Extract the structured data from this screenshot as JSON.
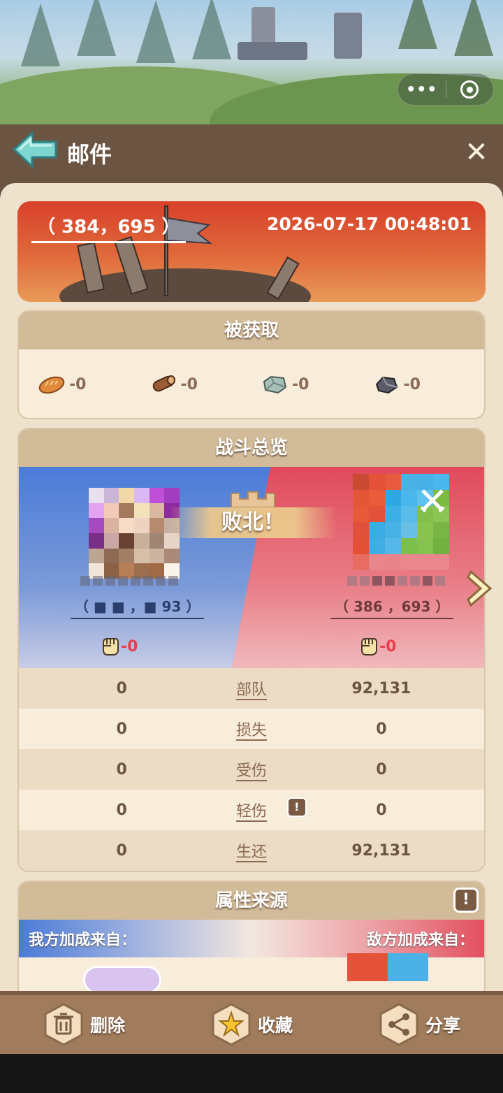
{
  "system": {
    "capsule_more": "•••"
  },
  "header": {
    "title": "邮件",
    "close": "✕"
  },
  "report": {
    "coord": "（ 384，695 ）",
    "datetime": "2026-07-17 00:48:01"
  },
  "captured": {
    "title": "被获取",
    "resources": [
      {
        "icon": "bread-icon",
        "value": "-0"
      },
      {
        "icon": "wood-log-icon",
        "value": "-0"
      },
      {
        "icon": "stone-icon",
        "value": "-0"
      },
      {
        "icon": "iron-ore-icon",
        "value": "-0"
      }
    ]
  },
  "overview": {
    "title": "战斗总览",
    "result": "败北！",
    "left": {
      "coord": "（ ■ ■ ，■ 93 ）",
      "power": "-0"
    },
    "right": {
      "coord": "（ 386 ，693 ）",
      "power": "-0"
    },
    "rows": [
      {
        "label": "部队",
        "left": "0",
        "right": "92,131"
      },
      {
        "label": "损失",
        "left": "0",
        "right": "0"
      },
      {
        "label": "受伤",
        "left": "0",
        "right": "0"
      },
      {
        "label": "轻伤",
        "left": "0",
        "right": "0",
        "info": "!"
      },
      {
        "label": "生还",
        "left": "0",
        "right": "92,131"
      }
    ]
  },
  "attributes": {
    "title": "属性来源",
    "info": "!",
    "ours": "我方加成来自：",
    "enemy": "敌方加成来自："
  },
  "toolbar": {
    "delete": "删除",
    "favorite": "收藏",
    "share": "分享"
  },
  "colors": {
    "header": "#6b5442",
    "card": "#efe2cd",
    "accent_red": "#e9404e",
    "accent_blue": "#4b7bd8"
  }
}
